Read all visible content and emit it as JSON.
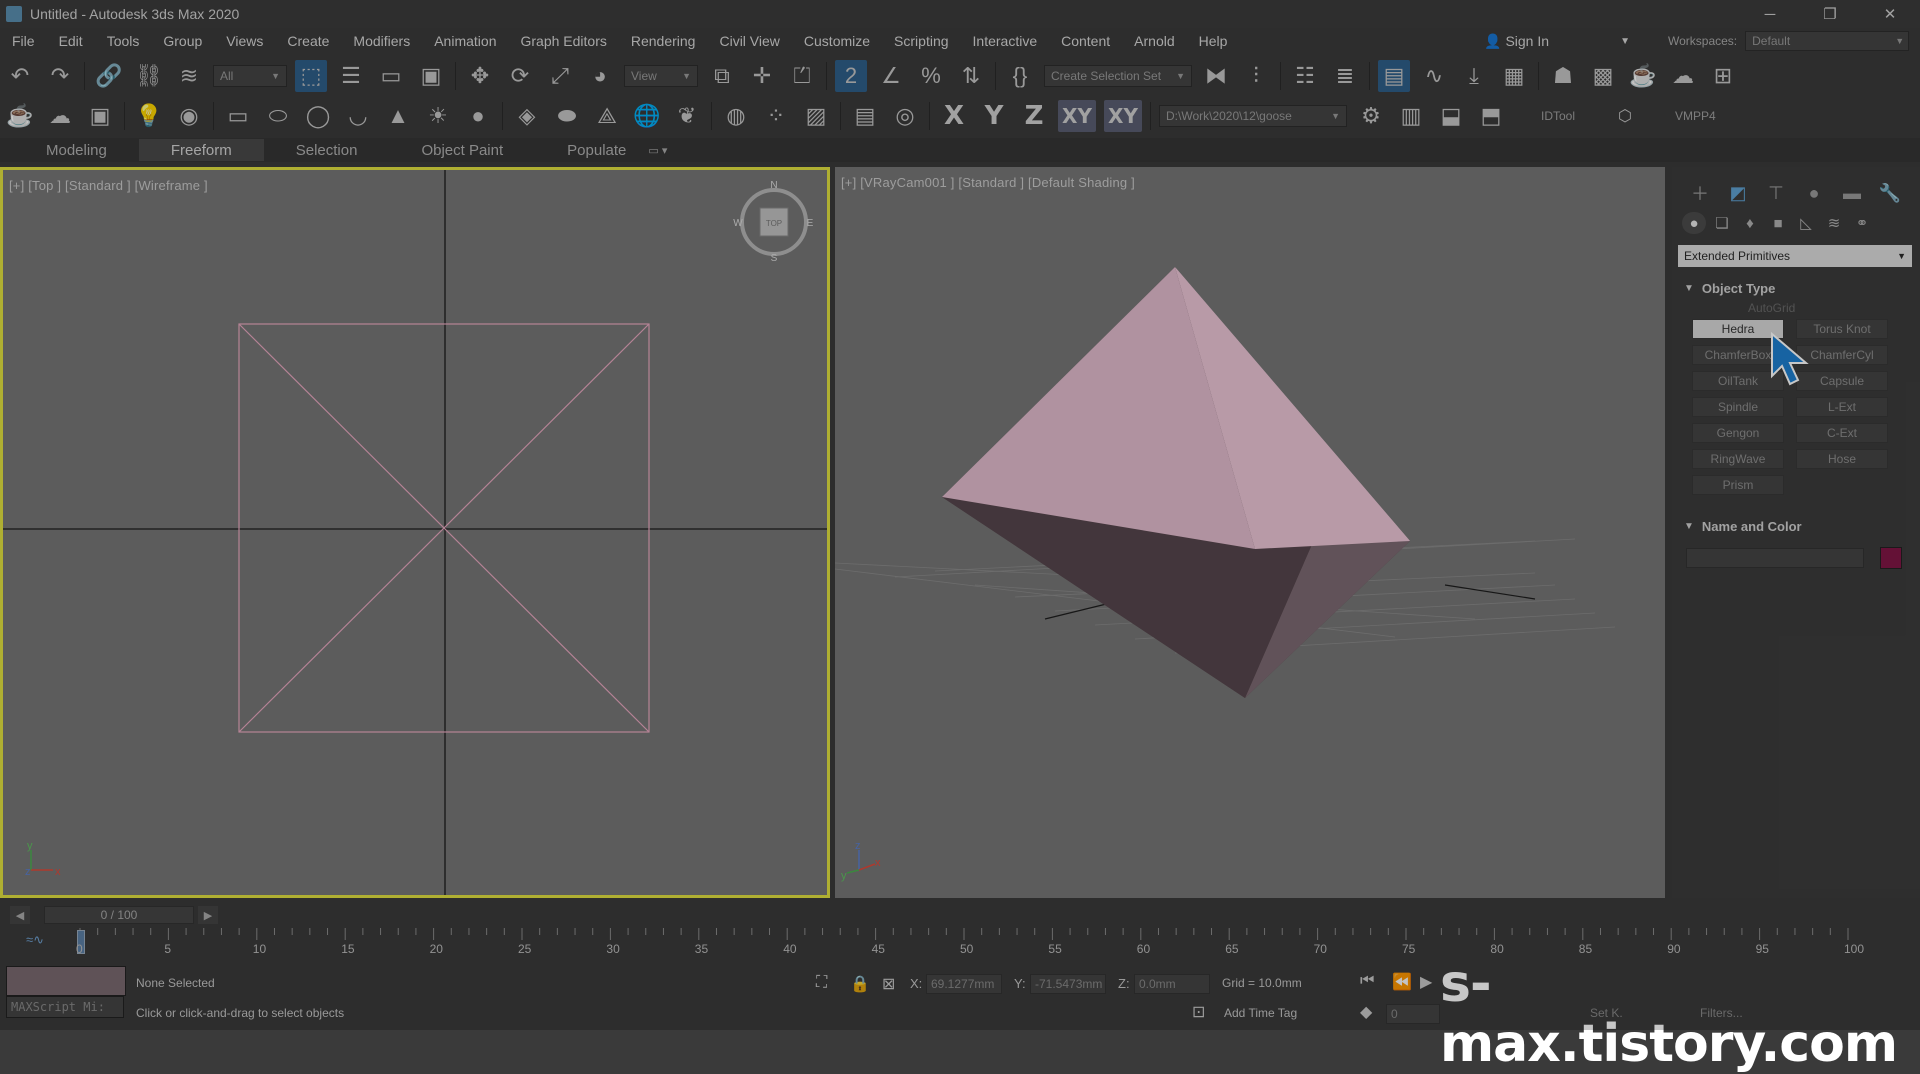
{
  "window": {
    "title": "Untitled - Autodesk 3ds Max 2020",
    "min": "─",
    "max": "❐",
    "close": "✕"
  },
  "menu": [
    "File",
    "Edit",
    "Tools",
    "Group",
    "Views",
    "Create",
    "Modifiers",
    "Animation",
    "Graph Editors",
    "Rendering",
    "Civil View",
    "Customize",
    "Scripting",
    "Interactive",
    "Content",
    "Arnold",
    "Help"
  ],
  "account": {
    "sign_in": "Sign In",
    "workspaces_label": "Workspaces:",
    "workspace": "Default"
  },
  "toolbar": {
    "filter": "All",
    "ref_coord": "View",
    "selection_set": "Create Selection Set",
    "axis_x": "X",
    "axis_y": "Y",
    "axis_z": "Z",
    "axis_xy": "XY",
    "axis_xy2": "XY",
    "project_path": "D:\\Work\\2020\\12\\goose",
    "idtool": "IDTool",
    "vmpp": "VMPP4"
  },
  "ribbon": {
    "tabs": [
      "Modeling",
      "Freeform",
      "Selection",
      "Object Paint",
      "Populate"
    ],
    "active": "Freeform"
  },
  "viewports": {
    "top": {
      "label": "[+] [Top ] [Standard ] [Wireframe ]",
      "viewcube": "TOP",
      "n": "N",
      "s": "S",
      "w": "W",
      "e": "E",
      "gizmo_y": "y",
      "gizmo_z": "z",
      "gizmo_x": "x"
    },
    "cam": {
      "label": "[+] [VRayCam001 ] [Standard ] [Default Shading ]",
      "gizmo_z": "z",
      "gizmo_y": "y",
      "gizmo_x": "x"
    }
  },
  "command_panel": {
    "category": "Extended Primitives",
    "object_type_title": "Object Type",
    "autogrid": "AutoGrid",
    "buttons": [
      "Hedra",
      "Torus Knot",
      "ChamferBox",
      "ChamferCyl",
      "OilTank",
      "Capsule",
      "Spindle",
      "L-Ext",
      "Gengon",
      "C-Ext",
      "RingWave",
      "Hose",
      "Prism"
    ],
    "active_button": "Hedra",
    "name_color_title": "Name and Color",
    "object_color": "#801646"
  },
  "timeline": {
    "frame": "0 / 100",
    "ticks": [
      "0",
      "5",
      "10",
      "15",
      "20",
      "25",
      "30",
      "35",
      "40",
      "45",
      "50",
      "55",
      "60",
      "65",
      "70",
      "75",
      "80",
      "85",
      "90",
      "95",
      "100"
    ]
  },
  "status": {
    "maxscript": "MAXScript Mi:",
    "selection": "None Selected",
    "prompt": "Click or click-and-drag to select objects",
    "x_label": "X:",
    "x_value": "69.1277mm",
    "y_label": "Y:",
    "y_value": "-71.5473mm",
    "z_label": "Z:",
    "z_value": "0.0mm",
    "grid": "Grid = 10.0mm",
    "add_time_tag": "Add Time Tag",
    "frame_field": "0",
    "set_key": "Set K.",
    "filters": "Filters..."
  },
  "watermark": "s-max.tistory.com",
  "colors": {
    "accent": "#2f5f8a",
    "viewport_active_border": "#e0e040",
    "hedra_light": "#e9c2d4",
    "hedra_shadow": "#57464d",
    "wire": "#e8a8c0"
  }
}
